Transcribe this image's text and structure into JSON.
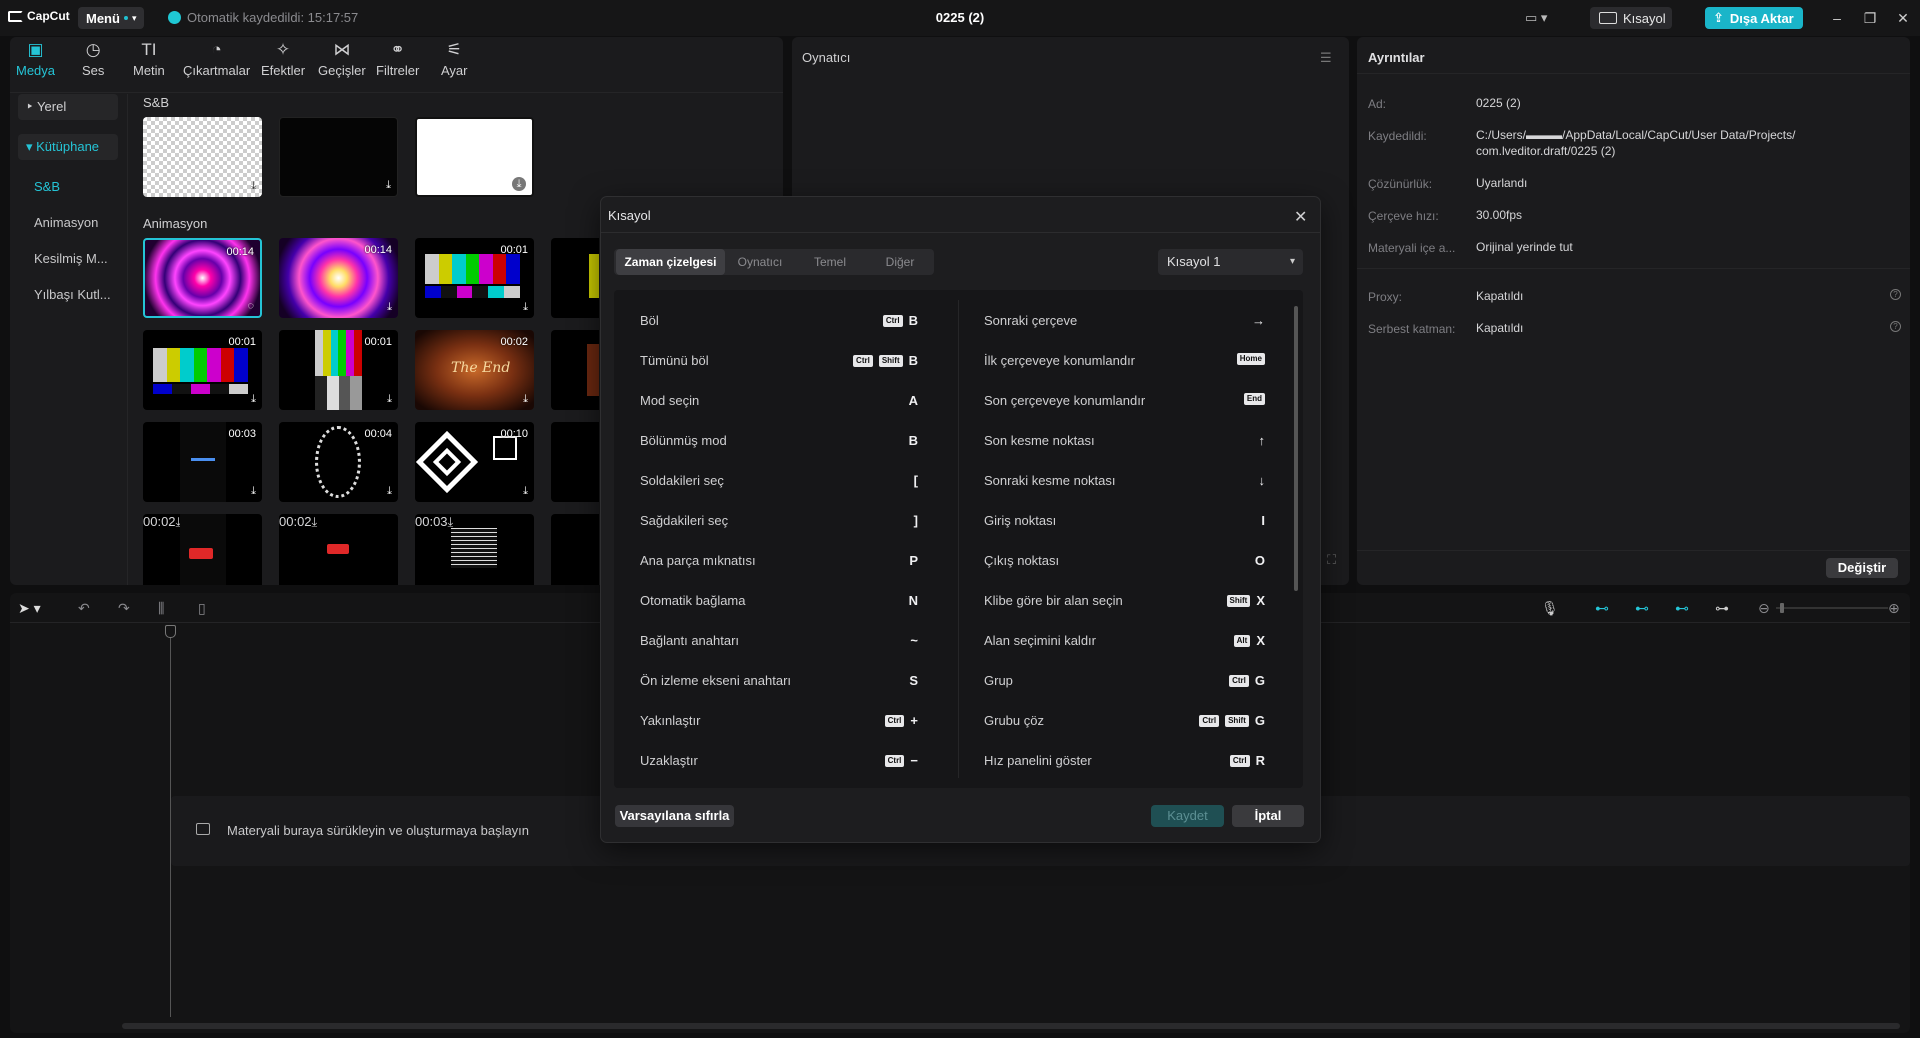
{
  "titlebar": {
    "logo": "CapCut",
    "menu": "Menü",
    "autosave": "Otomatik kaydedildi: 15:17:57",
    "project_title": "0225 (2)",
    "shortcut_btn": "Kısayol",
    "export_btn": "Dışa Aktar"
  },
  "media": {
    "tabs": [
      {
        "label": "Medya",
        "icon": "media-icon"
      },
      {
        "label": "Ses",
        "icon": "audio-icon"
      },
      {
        "label": "Metin",
        "icon": "text-icon"
      },
      {
        "label": "Çıkartmalar",
        "icon": "sticker-icon"
      },
      {
        "label": "Efektler",
        "icon": "effects-icon"
      },
      {
        "label": "Geçişler",
        "icon": "transitions-icon"
      },
      {
        "label": "Filtreler",
        "icon": "filters-icon"
      },
      {
        "label": "Ayar",
        "icon": "adjust-icon"
      }
    ],
    "sidebar": {
      "local": "Yerel",
      "library": "Kütüphane",
      "sub": [
        "S&B",
        "Animasyon",
        "Kesilmiş M...",
        "Yılbaşı Kutl..."
      ]
    },
    "sections": {
      "sb": "S&B",
      "animation": "Animasyon"
    },
    "durations": [
      "00:14",
      "00:14",
      "00:01",
      "00:01",
      "00:01",
      "00:02",
      "00:03",
      "00:04",
      "00:10",
      "00:02",
      "00:02",
      "00:03"
    ]
  },
  "player": {
    "title": "Oynatıcı"
  },
  "details": {
    "title": "Ayrıntılar",
    "rows": [
      {
        "label": "Ad:",
        "value": "0225 (2)"
      },
      {
        "label": "Kaydedildi:",
        "value": "C:/Users/▬▬▬/AppData/Local/CapCut/User Data/Projects/ com.lveditor.draft/0225 (2)"
      },
      {
        "label": "Çözünürlük:",
        "value": "Uyarlandı"
      },
      {
        "label": "Çerçeve hızı:",
        "value": "30.00fps"
      },
      {
        "label": "Materyali içe a...",
        "value": "Orijinal yerinde tut"
      },
      {
        "label": "Proxy:",
        "value": "Kapatıldı"
      },
      {
        "label": "Serbest katman:",
        "value": "Kapatıldı"
      }
    ],
    "change_btn": "Değiştir"
  },
  "timeline": {
    "drop_text": "Materyali buraya sürükleyin ve oluşturmaya başlayın"
  },
  "dialog": {
    "title": "Kısayol",
    "tabs": [
      "Zaman çizelgesi",
      "Oynatıcı",
      "Temel",
      "Diğer"
    ],
    "preset": "Kısayol 1",
    "left": [
      {
        "name": "Böl",
        "mods": [
          "Ctrl"
        ],
        "key": "B"
      },
      {
        "name": "Tümünü böl",
        "mods": [
          "Ctrl",
          "Shift"
        ],
        "key": "B"
      },
      {
        "name": "Mod seçin",
        "mods": [],
        "key": "A"
      },
      {
        "name": "Bölünmüş mod",
        "mods": [],
        "key": "B"
      },
      {
        "name": "Soldakileri seç",
        "mods": [],
        "key": "["
      },
      {
        "name": "Sağdakileri seç",
        "mods": [],
        "key": "]"
      },
      {
        "name": "Ana parça mıknatısı",
        "mods": [],
        "key": "P"
      },
      {
        "name": "Otomatik bağlama",
        "mods": [],
        "key": "N"
      },
      {
        "name": "Bağlantı anahtarı",
        "mods": [],
        "key": "~"
      },
      {
        "name": "Ön izleme ekseni anahtarı",
        "mods": [],
        "key": "S"
      },
      {
        "name": "Yakınlaştır",
        "mods": [
          "Ctrl"
        ],
        "key": "+"
      },
      {
        "name": "Uzaklaştır",
        "mods": [
          "Ctrl"
        ],
        "key": "−"
      }
    ],
    "right": [
      {
        "name": "Sonraki çerçeve",
        "mods": [],
        "key": "→"
      },
      {
        "name": "İlk çerçeveye konumlandır",
        "mods": [
          "Home"
        ],
        "key": ""
      },
      {
        "name": "Son çerçeveye konumlandır",
        "mods": [
          "End"
        ],
        "key": ""
      },
      {
        "name": "Son kesme noktası",
        "mods": [],
        "key": "↑"
      },
      {
        "name": "Sonraki kesme noktası",
        "mods": [],
        "key": "↓"
      },
      {
        "name": "Giriş noktası",
        "mods": [],
        "key": "I"
      },
      {
        "name": "Çıkış noktası",
        "mods": [],
        "key": "O"
      },
      {
        "name": "Klibe göre bir alan seçin",
        "mods": [
          "Shift"
        ],
        "key": "X"
      },
      {
        "name": "Alan seçimini kaldır",
        "mods": [
          "Alt"
        ],
        "key": "X"
      },
      {
        "name": "Grup",
        "mods": [
          "Ctrl"
        ],
        "key": "G"
      },
      {
        "name": "Grubu çöz",
        "mods": [
          "Ctrl",
          "Shift"
        ],
        "key": "G"
      },
      {
        "name": "Hız panelini göster",
        "mods": [
          "Ctrl"
        ],
        "key": "R"
      }
    ],
    "reset_btn": "Varsayılana sıfırla",
    "save_btn": "Kaydet",
    "cancel_btn": "İptal"
  },
  "colors": {
    "accent": "#1ab5c9",
    "background": "#0f0f10",
    "panel": "#1b1b1d"
  }
}
